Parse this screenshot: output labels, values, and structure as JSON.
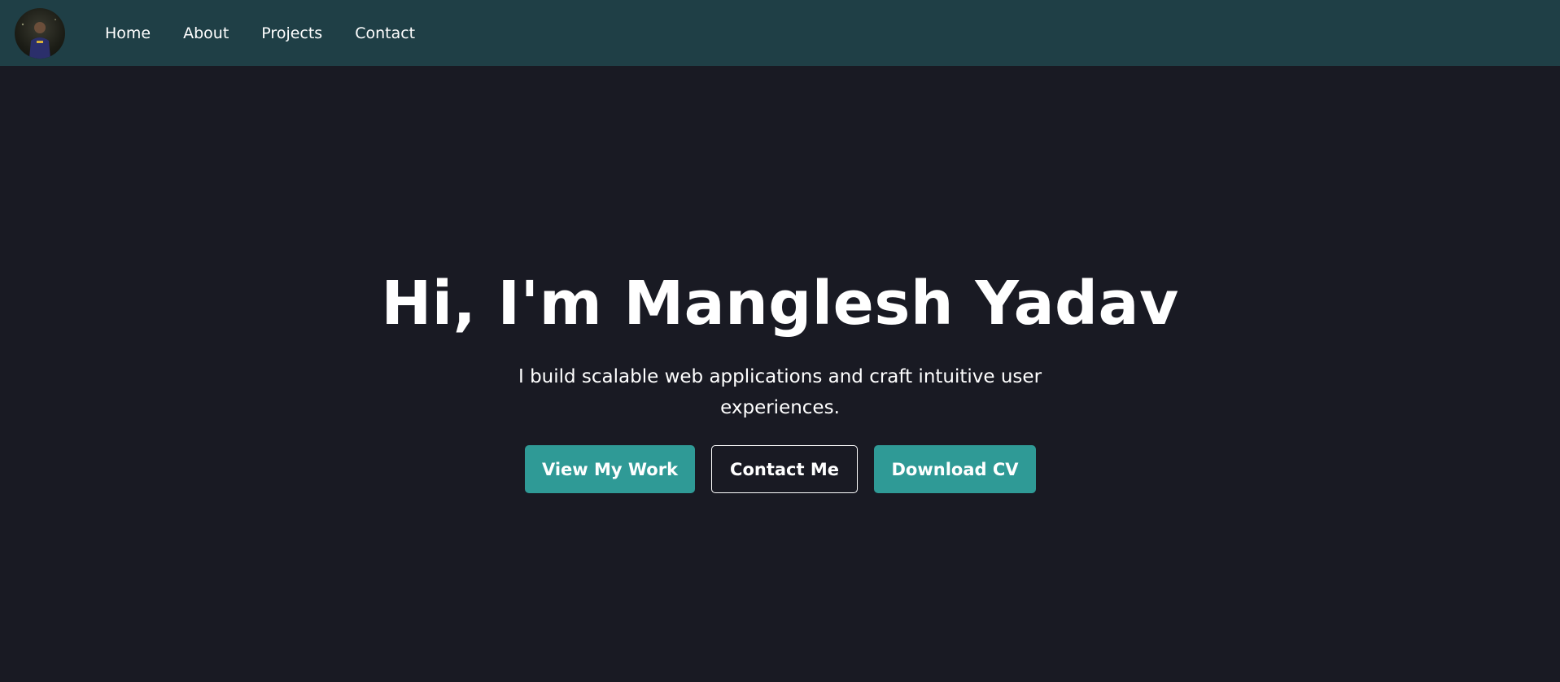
{
  "nav": {
    "avatar_alt": "Manglesh Yadav",
    "links": [
      {
        "label": "Home"
      },
      {
        "label": "About"
      },
      {
        "label": "Projects"
      },
      {
        "label": "Contact"
      }
    ]
  },
  "hero": {
    "title": "Hi, I'm Manglesh Yadav",
    "subtitle": "I build scalable web applications and craft intuitive user experiences.",
    "buttons": {
      "view_work": "View My Work",
      "contact_me": "Contact Me",
      "download_cv": "Download CV"
    }
  },
  "colors": {
    "navbar_bg": "#1f3f46",
    "page_bg": "#191a23",
    "accent": "#2f9a96",
    "text": "#ffffff"
  }
}
